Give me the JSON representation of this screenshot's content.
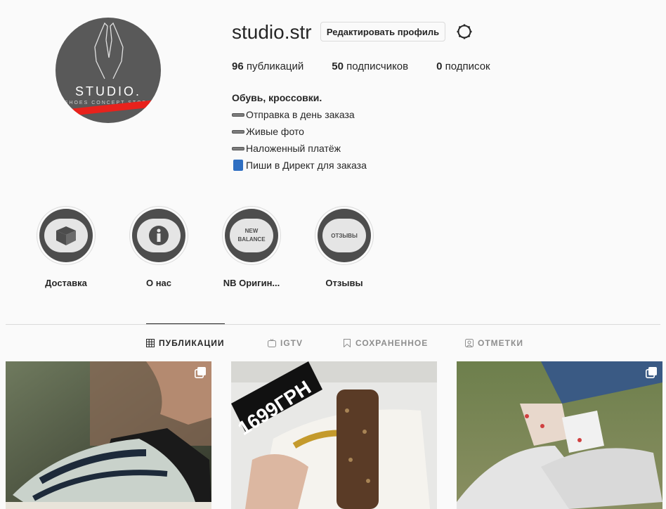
{
  "profile": {
    "username": "studio.str",
    "edit_label": "Редактировать профиль",
    "avatar_text": "STUDIO.",
    "avatar_subtext": "SHOES CONCEPT STORE"
  },
  "stats": [
    {
      "count": "96",
      "label": "публикаций"
    },
    {
      "count": "50",
      "label": "подписчиков"
    },
    {
      "count": "0",
      "label": "подписок"
    }
  ],
  "bio": {
    "name": "Обувь, кроссовки.",
    "lines": [
      "Отправка в день заказа",
      "Живые фото",
      "Наложенный платёж",
      "Пиши в Директ для заказа"
    ]
  },
  "highlights": [
    {
      "label": "Доставка",
      "icon": "box-icon"
    },
    {
      "label": "О нас",
      "icon": "info-icon"
    },
    {
      "label": "NB Оригин...",
      "icon": "new-balance-icon",
      "inner_text": "NEW BALANCE"
    },
    {
      "label": "Отзывы",
      "icon": "reviews-icon",
      "inner_text": "ОТЗЫВЫ"
    }
  ],
  "tabs": [
    {
      "label": "ПУБЛИКАЦИИ",
      "icon": "grid-icon",
      "active": true
    },
    {
      "label": "IGTV",
      "icon": "igtv-icon",
      "active": false
    },
    {
      "label": "СОХРАНЕННОЕ",
      "icon": "bookmark-icon",
      "active": false
    },
    {
      "label": "ОТМЕТКИ",
      "icon": "tagged-icon",
      "active": false
    }
  ],
  "posts": [
    {
      "overlay_text": ""
    },
    {
      "overlay_text": "1699ГРН"
    },
    {
      "overlay_text": ""
    }
  ],
  "colors": {
    "text": "#262626",
    "muted": "#8e8e8e",
    "border": "#dbdbdb",
    "bg": "#fafafa"
  }
}
